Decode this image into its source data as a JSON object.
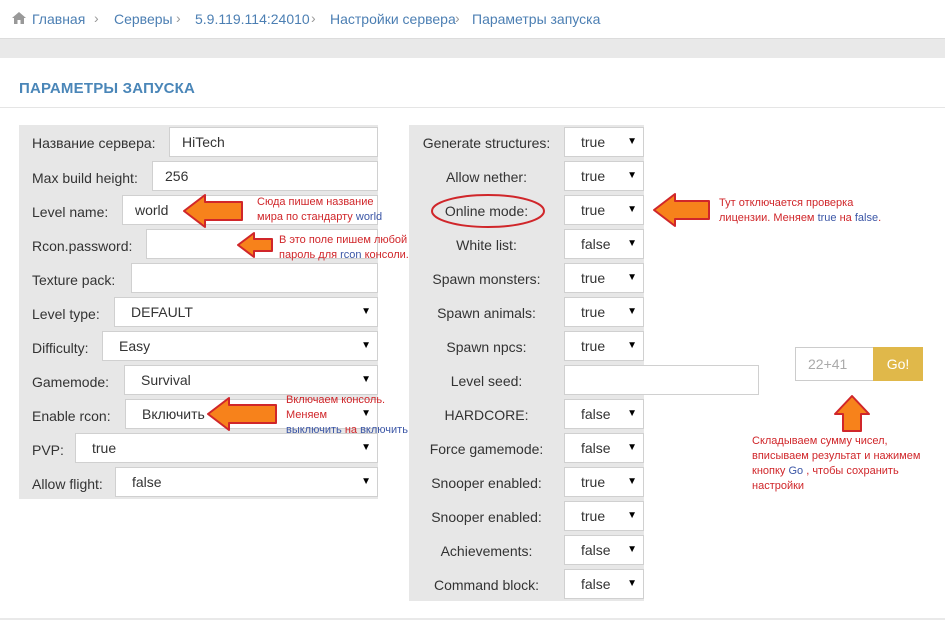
{
  "breadcrumb": [
    "Главная",
    "Серверы",
    "5.9.119.114:24010",
    "Настройки сервера",
    "Параметры запуска"
  ],
  "title": "ПАРАМЕТРЫ ЗАПУСКА",
  "left": {
    "server_name": {
      "label": "Название сервера:",
      "value": "HiTech"
    },
    "max_build": {
      "label": "Max build height:",
      "value": "256"
    },
    "level_name": {
      "label": "Level name:",
      "value": "world"
    },
    "rcon_password": {
      "label": "Rcon.password:",
      "value": ""
    },
    "texture_pack": {
      "label": "Texture pack:",
      "value": ""
    },
    "level_type": {
      "label": "Level type:",
      "value": "DEFAULT"
    },
    "difficulty": {
      "label": "Difficulty:",
      "value": "Easy"
    },
    "gamemode": {
      "label": "Gamemode:",
      "value": "Survival"
    },
    "enable_rcon": {
      "label": "Enable rcon:",
      "value": "Включить"
    },
    "pvp": {
      "label": "PVP:",
      "value": "true"
    },
    "allow_flight": {
      "label": "Allow flight:",
      "value": "false"
    }
  },
  "right": {
    "generate_structures": {
      "label": "Generate structures:",
      "value": "true"
    },
    "allow_nether": {
      "label": "Allow nether:",
      "value": "true"
    },
    "online_mode": {
      "label": "Online mode:",
      "value": "true"
    },
    "white_list": {
      "label": "White list:",
      "value": "false"
    },
    "spawn_monsters": {
      "label": "Spawn monsters:",
      "value": "true"
    },
    "spawn_animals": {
      "label": "Spawn animals:",
      "value": "true"
    },
    "spawn_npcs": {
      "label": "Spawn npcs:",
      "value": "true"
    },
    "level_seed": {
      "label": "Level seed:",
      "value": ""
    },
    "hardcore": {
      "label": "HARDCORE:",
      "value": "false"
    },
    "force_gamemode": {
      "label": "Force gamemode:",
      "value": "false"
    },
    "snooper1": {
      "label": "Snooper enabled:",
      "value": "true"
    },
    "snooper2": {
      "label": "Snooper enabled:",
      "value": "true"
    },
    "achievements": {
      "label": "Achievements:",
      "value": "false"
    },
    "command_block": {
      "label": "Command block:",
      "value": "false"
    }
  },
  "captcha": {
    "placeholder": "22+41",
    "button": "Go!"
  },
  "annotations": {
    "level_name": [
      "Сюда пишем название",
      "мира по стандарту ",
      "world"
    ],
    "rcon": [
      "В это поле пишем любой",
      "пароль для ",
      "rcon",
      " консоли."
    ],
    "enable_rcon": [
      "Включаем консоль.",
      "Меняем",
      "выключить",
      " на ",
      "включить"
    ],
    "online": [
      "Тут отключается проверка",
      "лицензии. Меняем ",
      "true",
      " на ",
      "false",
      "."
    ],
    "captcha": [
      "Складываем сумму чисел,",
      "вписываем результат и нажимем",
      "кнопку ",
      "Go",
      " , чтобы сохранить",
      "настройки"
    ]
  },
  "colors": {
    "accent": "#4a86b8",
    "go": "#e0b84a",
    "arrow": "#f7821b",
    "annotation": "#d0262a"
  }
}
